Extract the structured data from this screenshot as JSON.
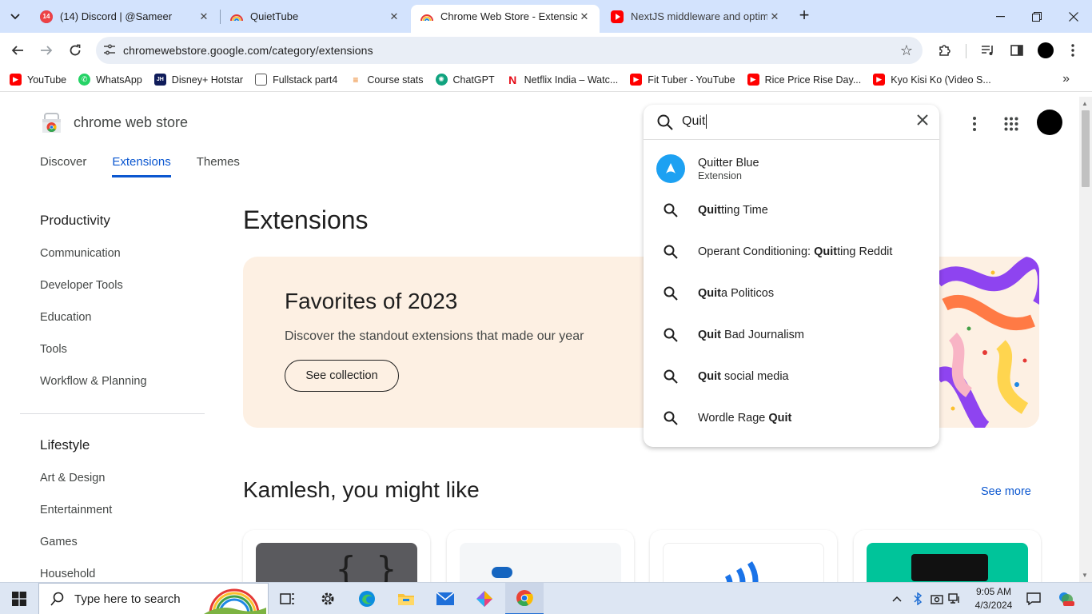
{
  "browser": {
    "tabs": [
      {
        "title": "(14) Discord | @Sameer",
        "badge": "14",
        "active": false
      },
      {
        "title": "QuietTube",
        "active": false
      },
      {
        "title": "Chrome Web Store - Extensions",
        "active": true
      },
      {
        "title": "NextJS middleware and optimis",
        "active": false
      }
    ],
    "url": "chromewebstore.google.com/category/extensions",
    "bookmarks": [
      {
        "label": "YouTube",
        "icon": "youtube-icon",
        "color": "#ff0000"
      },
      {
        "label": "WhatsApp",
        "icon": "whatsapp-icon",
        "color": "#25d366"
      },
      {
        "label": "Disney+ Hotstar",
        "icon": "hotstar-icon",
        "color": "#0f1c5a"
      },
      {
        "label": "Fullstack part4",
        "icon": "page-icon",
        "color": "#555555"
      },
      {
        "label": "Course stats",
        "icon": "course-icon",
        "color": "#e8710a"
      },
      {
        "label": "ChatGPT",
        "icon": "chatgpt-icon",
        "color": "#10a37f"
      },
      {
        "label": "Netflix India – Watc...",
        "icon": "netflix-icon",
        "color": "#e50914"
      },
      {
        "label": "Fit Tuber - YouTube",
        "icon": "youtube-icon",
        "color": "#ff0000"
      },
      {
        "label": "Rice Price Rise Day...",
        "icon": "youtube-icon",
        "color": "#ff0000"
      },
      {
        "label": "Kyo Kisi Ko (Video S...",
        "icon": "youtube-icon",
        "color": "#ff0000"
      }
    ]
  },
  "store": {
    "logo_text": "chrome web store",
    "nav": [
      {
        "label": "Discover",
        "active": false
      },
      {
        "label": "Extensions",
        "active": true
      },
      {
        "label": "Themes",
        "active": false
      }
    ],
    "sidebar": {
      "productivity_heading": "Productivity",
      "productivity_items": [
        "Communication",
        "Developer Tools",
        "Education",
        "Tools",
        "Workflow & Planning"
      ],
      "lifestyle_heading": "Lifestyle",
      "lifestyle_items": [
        "Art & Design",
        "Entertainment",
        "Games",
        "Household"
      ]
    },
    "heading": "Extensions",
    "banner": {
      "title": "Favorites of 2023",
      "subtitle": "Discover the standout extensions that made our year",
      "button": "See collection"
    },
    "recommend": {
      "heading": "Kamlesh, you might like",
      "see_more": "See more"
    },
    "search": {
      "value": "Quit",
      "suggestions": [
        {
          "type": "extension",
          "title": "Quitter Blue",
          "subtitle": "Extension"
        },
        {
          "type": "query",
          "pre": "",
          "bold": "Quit",
          "post": "ting Time"
        },
        {
          "type": "query",
          "pre": "Operant Conditioning: ",
          "bold": "Quit",
          "post": "ting Reddit"
        },
        {
          "type": "query",
          "pre": "",
          "bold": "Quit",
          "post": "a Politicos"
        },
        {
          "type": "query",
          "pre": "",
          "bold": "Quit",
          "post": " Bad Journalism"
        },
        {
          "type": "query",
          "pre": "",
          "bold": "Quit",
          "post": " social media"
        },
        {
          "type": "query",
          "pre": "Wordle Rage ",
          "bold": "Quit",
          "post": ""
        }
      ]
    }
  },
  "taskbar": {
    "search_placeholder": "Type here to search",
    "time": "9:05 AM",
    "date": "4/3/2024"
  }
}
